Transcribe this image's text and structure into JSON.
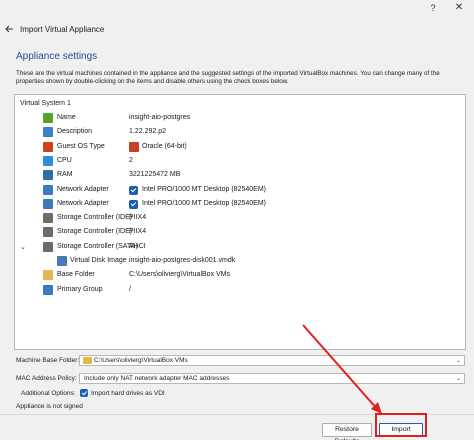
{
  "window": {
    "help_glyph": "?",
    "close_glyph": "✕",
    "wizard_title": "Import Virtual Appliance"
  },
  "page": {
    "section_title": "Appliance settings",
    "description": "These are the virtual machines contained in the appliance and the suggested settings of the imported VirtualBox machines. You can change many of the properties shown by double-clicking on the items and disable others using the check boxes below."
  },
  "tree": {
    "system_label": "Virtual System 1",
    "rows": [
      {
        "label": "Name",
        "value": "insight-aio-postgres",
        "icon": "name-icon",
        "color": "#5aa02c"
      },
      {
        "label": "Description",
        "value": "1.22.292.p2",
        "icon": "description-icon",
        "color": "#3c7fc4"
      },
      {
        "label": "Guest OS Type",
        "value": "Oracle (64-bit)",
        "icon": "os-type-icon",
        "color": "#d04020"
      },
      {
        "label": "CPU",
        "value": "2",
        "icon": "cpu-icon",
        "color": "#2d8fd6"
      },
      {
        "label": "RAM",
        "value": "3221225472 MB",
        "icon": "ram-icon",
        "color": "#2d6fa8"
      },
      {
        "label": "Network Adapter",
        "value": "Intel PRO/1000 MT Desktop (82540EM)",
        "icon": "network-icon",
        "color": "#3a7bbf"
      },
      {
        "label": "Network Adapter",
        "value": "Intel PRO/1000 MT Desktop (82540EM)",
        "icon": "network-icon",
        "color": "#3a7bbf"
      },
      {
        "label": "Storage Controller (IDE)",
        "value": "PIIX4",
        "icon": "storage-ide-icon",
        "color": "#6b6b6b"
      },
      {
        "label": "Storage Controller (IDE)",
        "value": "PIIX4",
        "icon": "storage-ide-icon",
        "color": "#6b6b6b"
      },
      {
        "label": "Storage Controller (SATA)",
        "value": "AHCI",
        "icon": "storage-sata-icon",
        "color": "#6b6b6b"
      },
      {
        "label": "Virtual Disk Image",
        "value": "insight-aio-postgres-disk001.vmdk",
        "icon": "disk-icon",
        "color": "#4a78b5"
      },
      {
        "label": "Base Folder",
        "value": "C:\\Users\\olivierg\\VirtualBox VMs",
        "icon": "folder-icon",
        "color": "#e6b84c"
      },
      {
        "label": "Primary Group",
        "value": "/",
        "icon": "group-icon",
        "color": "#3b78c2"
      }
    ]
  },
  "options": {
    "base_folder_label": "Machine Base Folder:",
    "base_folder_value": "C:\\Users\\olivierg\\VirtualBox VMs",
    "mac_label": "MAC Address Policy:",
    "mac_value": "Include only NAT network adapter MAC addresses",
    "additional_label": "Additional Options:",
    "import_vdi_label": "Import hard drives as VDI",
    "signed_status": "Appliance is not signed"
  },
  "footer": {
    "restore_label": "Restore Defaults",
    "import_label": "Import"
  },
  "colors": {
    "accent": "#1a5fb4",
    "section_title": "#1f4e9b",
    "annotation_red": "#e02020"
  }
}
